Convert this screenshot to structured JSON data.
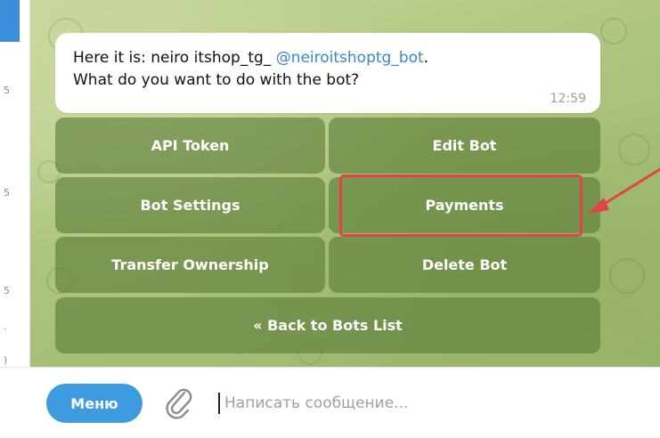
{
  "message": {
    "text_prefix": "Here it is: neiro itshop_tg_ ",
    "bot_handle": "@neiroitshoptg_bot",
    "text_suffix": ".",
    "line2": "What do you want to do with the bot?",
    "time": "12:59"
  },
  "keyboard": {
    "api_token": "API Token",
    "edit_bot": "Edit Bot",
    "bot_settings": "Bot Settings",
    "payments": "Payments",
    "transfer_ownership": "Transfer Ownership",
    "delete_bot": "Delete Bot",
    "back_to_list": "« Back to Bots List"
  },
  "input_bar": {
    "menu_label": "Меню",
    "placeholder": "Написать сообщение..."
  },
  "colors": {
    "accent_blue": "#3f9be0",
    "highlight_red": "#e0434a",
    "link_blue": "#3a87c9"
  },
  "icons": [
    "paperclip-icon",
    "arrow-annotation"
  ]
}
